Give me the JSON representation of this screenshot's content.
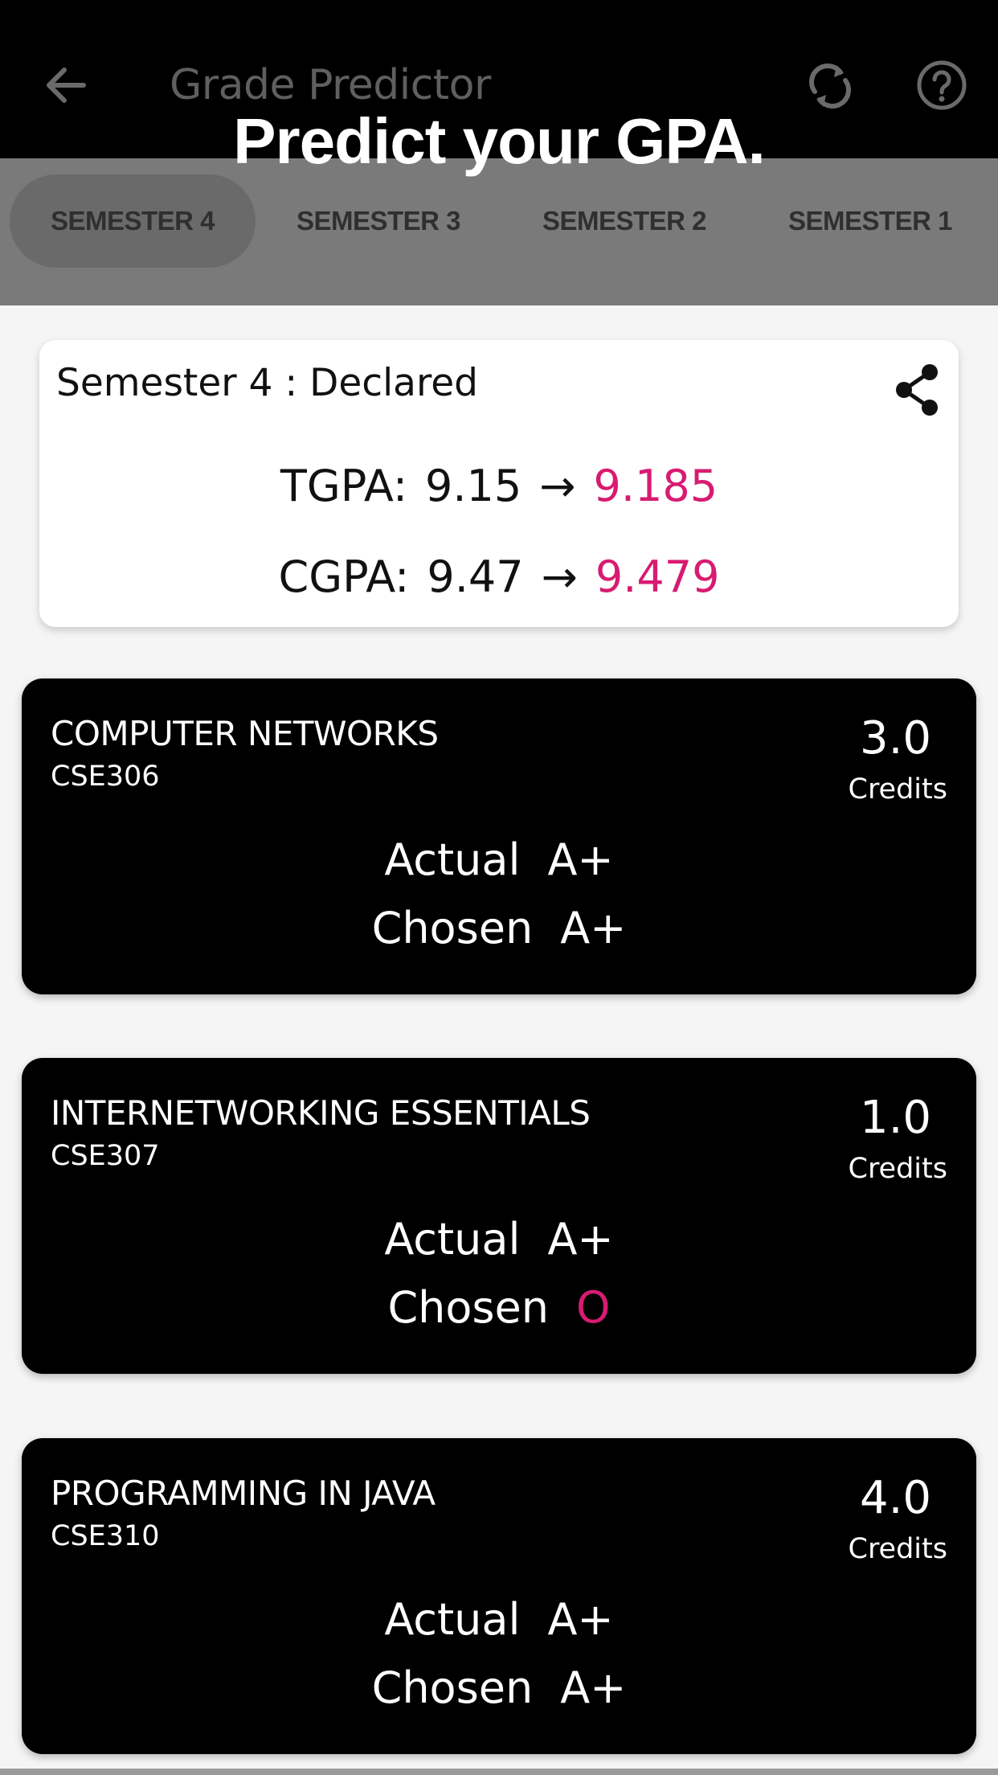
{
  "appbar": {
    "title": "Grade Predictor",
    "back_icon": "arrow-left-icon",
    "refresh_icon": "refresh-icon",
    "help_icon": "help-circle-icon"
  },
  "promo": {
    "text": "Predict your GPA."
  },
  "tabs": [
    {
      "label": "SEMESTER 4",
      "active": true
    },
    {
      "label": "SEMESTER 3",
      "active": false
    },
    {
      "label": "SEMESTER 2",
      "active": false
    },
    {
      "label": "SEMESTER 1",
      "active": false
    }
  ],
  "summary": {
    "heading": "Semester 4 : Declared",
    "share_icon": "share-icon",
    "tgpa": {
      "label": "TGPA:",
      "old": "9.15",
      "arrow": "→",
      "new": "9.185"
    },
    "cgpa": {
      "label": "CGPA:",
      "old": "9.47",
      "arrow": "→",
      "new": "9.479"
    }
  },
  "courses": [
    {
      "name": "COMPUTER NETWORKS",
      "code": "CSE306",
      "credits": "3.0",
      "credits_label": "Credits",
      "actual_label": "Actual",
      "actual": "A+",
      "chosen_label": "Chosen",
      "chosen": "A+"
    },
    {
      "name": "INTERNETWORKING ESSENTIALS",
      "code": "CSE307",
      "credits": "1.0",
      "credits_label": "Credits",
      "actual_label": "Actual",
      "actual": "A+",
      "chosen_label": "Chosen",
      "chosen": "O"
    },
    {
      "name": "PROGRAMMING IN JAVA",
      "code": "CSE310",
      "credits": "4.0",
      "credits_label": "Credits",
      "actual_label": "Actual",
      "actual": "A+",
      "chosen_label": "Chosen",
      "chosen": "A+"
    }
  ],
  "colors": {
    "accent": "#d81b72",
    "appbar_bg": "#000000",
    "tab_strip_bg": "#7a7a7a",
    "card_bg": "#000000"
  }
}
